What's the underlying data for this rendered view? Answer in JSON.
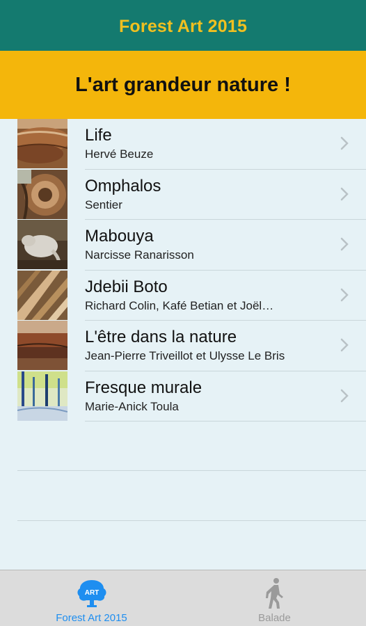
{
  "nav": {
    "title": "Forest Art 2015"
  },
  "banner": {
    "text": "L'art grandeur nature !"
  },
  "artworks": [
    {
      "title": "Life",
      "artist": "Hervé Beuze"
    },
    {
      "title": "Omphalos",
      "artist": "Sentier"
    },
    {
      "title": "Mabouya",
      "artist": "Narcisse Ranarisson"
    },
    {
      "title": "Jdebii Boto",
      "artist": "Richard Colin, Kafé Betian et Joël…"
    },
    {
      "title": "L'être dans la nature",
      "artist": "Jean-Pierre Triveillot et Ulysse Le Bris"
    },
    {
      "title": "Fresque  murale",
      "artist": "Marie-Anick Toula"
    }
  ],
  "tabs": [
    {
      "label": "Forest Art 2015",
      "icon": "forest-art-logo-icon",
      "active": true
    },
    {
      "label": "Balade",
      "icon": "walking-person-icon",
      "active": false
    }
  ],
  "colors": {
    "nav_bg": "#147a6f",
    "nav_title": "#f1c020",
    "banner_bg": "#f4b60b",
    "list_bg": "#e6f2f6",
    "tab_active": "#1e8ef0",
    "tab_inactive": "#9a9a9a"
  }
}
